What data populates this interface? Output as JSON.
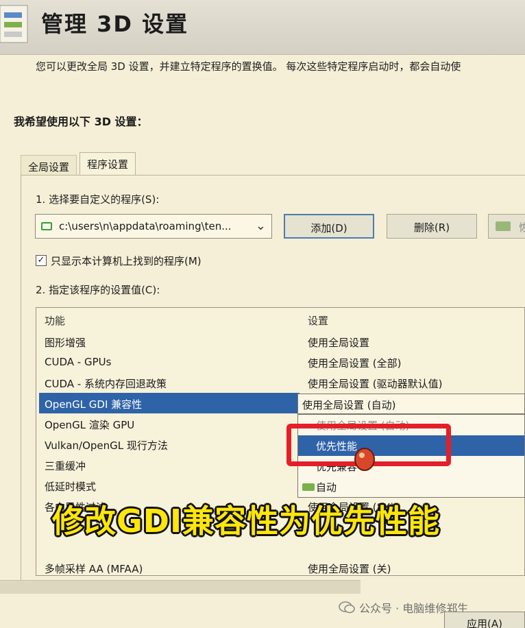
{
  "header": {
    "title": "管理 3D 设置",
    "description": "您可以更改全局 3D 设置，并建立特定程序的置换值。 每次这些特定程序启动时，都会自动使"
  },
  "section_heading": "我希望使用以下 3D 设置：",
  "tabs": [
    {
      "label": "全局设置",
      "active": false
    },
    {
      "label": "程序设置",
      "active": true
    }
  ],
  "step1": {
    "label": "1. 选择要自定义的程序(S):",
    "program_value": "c:\\users\\n\\appdata\\roaming\\ten...",
    "add_button": "添加(D)",
    "remove_button": "删除(R)",
    "restore_button": "恢"
  },
  "checkbox": {
    "label": "只显示本计算机上找到的程序(M)",
    "checked": true,
    "mark": "✓"
  },
  "step2": {
    "label": "2. 指定该程序的设置值(C):"
  },
  "table": {
    "col_feature": "功能",
    "col_setting": "设置",
    "rows": [
      {
        "feature": "图形增强",
        "setting": "使用全局设置"
      },
      {
        "feature": "CUDA - GPUs",
        "setting": "使用全局设置 (全部)"
      },
      {
        "feature": "CUDA - 系统内存回退政策",
        "setting": "使用全局设置 (驱动器默认值)"
      },
      {
        "feature": "OpenGL GDI 兼容性",
        "setting": ""
      },
      {
        "feature": "OpenGL 渲染 GPU",
        "setting": ""
      },
      {
        "feature": "Vulkan/OpenGL 现行方法",
        "setting": ""
      },
      {
        "feature": "三重缓冲",
        "setting": ""
      },
      {
        "feature": "低延时模式",
        "setting": ""
      },
      {
        "feature": "各向异性过滤",
        "setting": "使用全局设置 (8X)"
      },
      {
        "feature": "",
        "setting": ""
      },
      {
        "feature": "",
        "setting": ""
      },
      {
        "feature": "多帧采样 AA (MFAA)",
        "setting": "使用全局设置 (关)"
      }
    ]
  },
  "dropdown": {
    "current": "使用全局设置 (自动)",
    "options": [
      {
        "label": "使用全局设置 (自动)",
        "state": "faded"
      },
      {
        "label": "优先性能",
        "state": "highlighted"
      },
      {
        "label": "优先兼容",
        "state": "normal"
      },
      {
        "label": "自动",
        "state": "normal"
      }
    ]
  },
  "caption": "修改GDI兼容性为优先性能",
  "watermark": "公众号 · 电脑维修郑生",
  "apply_button": "应用(A)",
  "colors": {
    "background": "#f4efd6",
    "selection": "#2f63a8",
    "highlight_box": "#e3202a",
    "caption": "#ffe60a"
  }
}
